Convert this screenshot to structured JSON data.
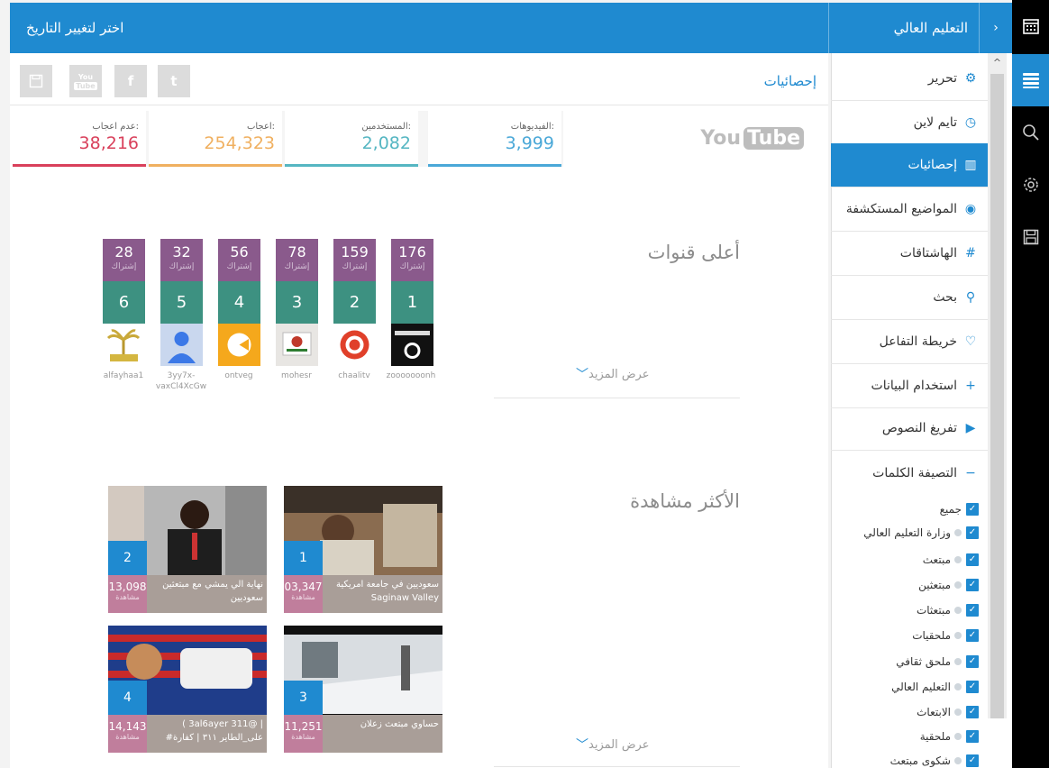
{
  "header": {
    "title": "التعليم العالي",
    "date_picker_label": "اختر لتغيير التاريخ"
  },
  "rail": {
    "icons": [
      "calendar-icon",
      "menu-icon",
      "search-icon",
      "gear-icon",
      "save-icon"
    ],
    "active_index": 1
  },
  "sidebar": {
    "items": [
      {
        "label": "تحرير",
        "icon": "gear-icon"
      },
      {
        "label": "تايم لاين",
        "icon": "clock-icon"
      },
      {
        "label": "إحصائيات",
        "icon": "bar-chart-icon",
        "active": true
      },
      {
        "label": "المواضيع المستكشفة",
        "icon": "target-icon"
      },
      {
        "label": "الهاشتاقات",
        "icon": "hashtag-icon"
      },
      {
        "label": "بحث",
        "icon": "search-icon"
      },
      {
        "label": "خريطة التفاعل",
        "icon": "map-pin-icon"
      },
      {
        "label": "استخدام البيانات",
        "icon": "plus-icon"
      },
      {
        "label": "تفريغ النصوص",
        "icon": "play-icon"
      },
      {
        "label": "التصيفة الكلمات",
        "icon": "minus-icon"
      }
    ],
    "categories": [
      {
        "label": "جميع",
        "checked": true,
        "dot": false
      },
      {
        "label": "وزارة التعليم العالي",
        "checked": true,
        "dot": true
      },
      {
        "label": "مبتعث",
        "checked": true,
        "dot": true
      },
      {
        "label": "مبتعثين",
        "checked": true,
        "dot": true
      },
      {
        "label": "مبتعثات",
        "checked": true,
        "dot": true
      },
      {
        "label": "ملحقيات",
        "checked": true,
        "dot": true
      },
      {
        "label": "ملحق ثقافي",
        "checked": true,
        "dot": true
      },
      {
        "label": "التعليم العالي",
        "checked": true,
        "dot": true
      },
      {
        "label": "الابتعاث",
        "checked": true,
        "dot": true
      },
      {
        "label": "ملحقية",
        "checked": true,
        "dot": true
      },
      {
        "label": "شكوى مبتعث",
        "checked": true,
        "dot": true
      }
    ]
  },
  "stats": {
    "title": "إحصائيات",
    "share_buttons": [
      "save-icon",
      "youtube-icon",
      "facebook-icon",
      "twitter-icon"
    ],
    "youtube_logo": {
      "you": "You",
      "tube": "Tube"
    },
    "counters": [
      {
        "label": "الفيديوهات:",
        "value": "3,999",
        "color": "#4aa8d8"
      },
      {
        "label": "المستخدمين:",
        "value": "2,082",
        "color": "#55b6c2"
      },
      {
        "label": "اعجاب:",
        "value": "254,323",
        "color": "#f0b060"
      },
      {
        "label": "عدم اعجاب:",
        "value": "38,216",
        "color": "#d9405b"
      }
    ]
  },
  "top_channels": {
    "title": "أعلى قنوات",
    "more_label": "عرض المزيد",
    "subscribers_label": "إشتراك",
    "channels": [
      {
        "rank": "1",
        "subs": "176",
        "name": "zooooooonh"
      },
      {
        "rank": "2",
        "subs": "159",
        "name": "chaalitv"
      },
      {
        "rank": "3",
        "subs": "78",
        "name": "mohesr"
      },
      {
        "rank": "4",
        "subs": "56",
        "name": "ontveg"
      },
      {
        "rank": "5",
        "subs": "32",
        "name": "3yy7x-vaxCl4XcGw"
      },
      {
        "rank": "6",
        "subs": "28",
        "name": "alfayhaa1"
      }
    ]
  },
  "most_viewed": {
    "title": "الأكثر مشاهدة",
    "more_label": "عرض المزيد",
    "views_label": "مشاهدة",
    "videos": [
      {
        "rank": "1",
        "views": "03,347",
        "title": "سعوديين في جامعة امريكية Saginaw Valley"
      },
      {
        "rank": "2",
        "views": "13,098",
        "title": "نهاية الي يمشي مع مبتعثين سعوديين"
      },
      {
        "rank": "3",
        "views": "11,251",
        "title": "حساوي مبتعث زعلان"
      },
      {
        "rank": "4",
        "views": "14,143",
        "title": "( 3al6ayer 311@ | #على_الطاير ٣١١ | كفارة"
      }
    ]
  }
}
